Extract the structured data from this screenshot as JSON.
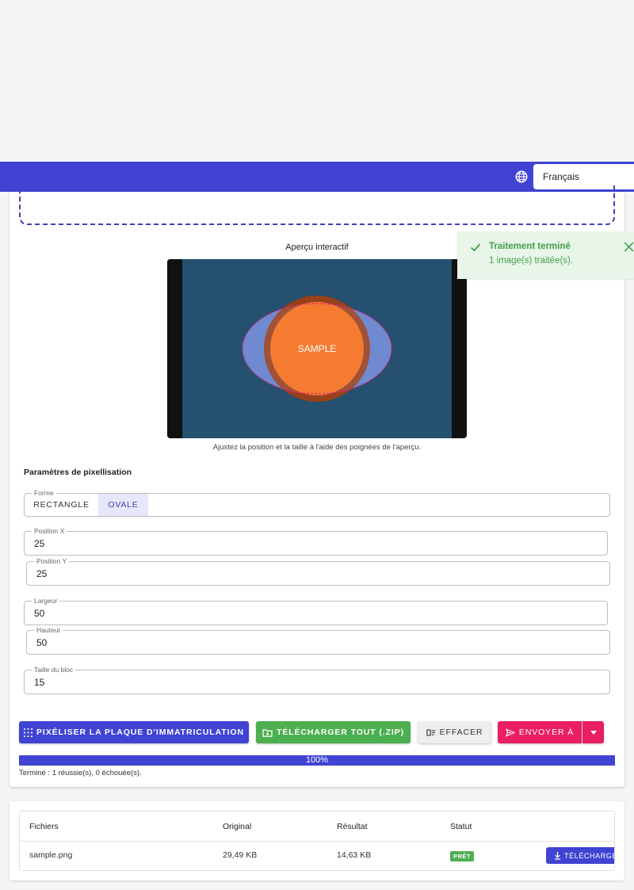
{
  "header": {
    "language": "Français"
  },
  "preview": {
    "title": "Aperçu interactif",
    "sample_text": "SAMPLE",
    "hint": "Ajustez la position et la taille à l'aide des poignées de l'aperçu."
  },
  "settings": {
    "section_title": "Paramètres de pixellisation",
    "shape_label": "Forme",
    "shapes": [
      "RECTANGLE",
      "OVALE"
    ],
    "selected_shape": "OVALE",
    "position_x_label": "Position X",
    "position_x": "25",
    "position_y_label": "Position Y",
    "position_y": "25",
    "width_label": "Largeur",
    "width": "50",
    "height_label": "Hauteur",
    "height": "50",
    "block_size_label": "Taille du bloc",
    "block_size": "15"
  },
  "actions": {
    "pixelate": "PIXÉLISER LA PLAQUE D'IMMATRICULATION",
    "download_all": "TÉLÉCHARGER TOUT (.ZIP)",
    "clear": "EFFACER",
    "send_to": "ENVOYER À"
  },
  "progress": {
    "percent": 100,
    "label": "100%",
    "status": "Terminé : 1 réussie(s), 0 échouée(s)."
  },
  "toast": {
    "title": "Traitement terminé",
    "message": "1 image(s) traitée(s)."
  },
  "table": {
    "headers": [
      "Fichiers",
      "Original",
      "Résultat",
      "Statut"
    ],
    "rows": [
      {
        "file": "sample.png",
        "original": "29,49 KB",
        "result": "14,63 KB",
        "status": "PRÊT",
        "action": "TÉLÉCHARGER"
      }
    ]
  },
  "colors": {
    "primary": "#4143d3",
    "success": "#4caf50",
    "accent": "#e91e63",
    "preview_bg": "#26506f",
    "circle": "#f47b30"
  }
}
